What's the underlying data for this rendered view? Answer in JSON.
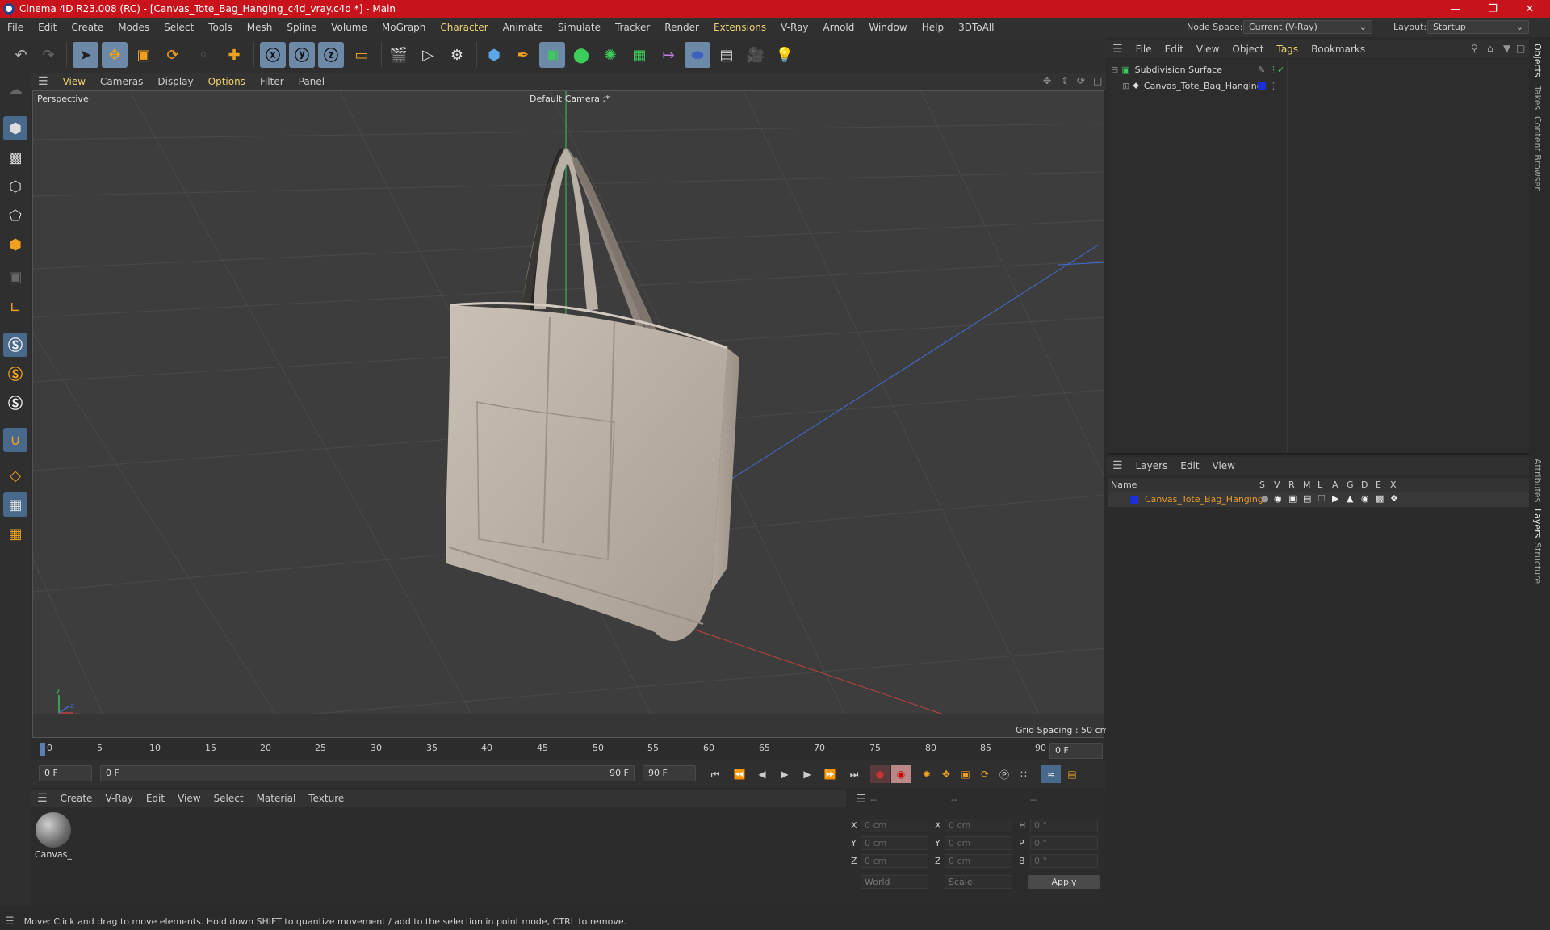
{
  "title": "Cinema 4D R23.008 (RC) - [Canvas_Tote_Bag_Hanging_c4d_vray.c4d *] - Main",
  "menu": [
    "File",
    "Edit",
    "Create",
    "Modes",
    "Select",
    "Tools",
    "Mesh",
    "Spline",
    "Volume",
    "MoGraph",
    "Character",
    "Animate",
    "Simulate",
    "Tracker",
    "Render",
    "Extensions",
    "V-Ray",
    "Arnold",
    "Window",
    "Help",
    "3DToAll"
  ],
  "node_space_label": "Node Space:",
  "node_space_value": "Current (V-Ray)",
  "layout_label": "Layout:",
  "layout_value": "Startup",
  "viewport": {
    "menu": [
      "View",
      "Cameras",
      "Display",
      "Options",
      "Filter",
      "Panel"
    ],
    "label": "Perspective",
    "camera": "Default Camera :*",
    "grid_spacing": "Grid Spacing : 50 cm"
  },
  "timeline": {
    "ticks": [
      "0",
      "5",
      "10",
      "15",
      "20",
      "25",
      "30",
      "35",
      "40",
      "45",
      "50",
      "55",
      "60",
      "65",
      "70",
      "75",
      "80",
      "85",
      "90"
    ],
    "current_frame_right": "0 F",
    "start": "0 F",
    "range_start": "0 F",
    "range_end": "90 F",
    "end": "90 F"
  },
  "materials": {
    "menu": [
      "Create",
      "V-Ray",
      "Edit",
      "View",
      "Select",
      "Material",
      "Texture"
    ],
    "items": [
      {
        "name": "Canvas_"
      }
    ]
  },
  "coords": {
    "headers": [
      "--",
      "--",
      "--"
    ],
    "rows": [
      {
        "a": "X",
        "av": "0 cm",
        "b": "X",
        "bv": "0 cm",
        "c": "H",
        "cv": "0 °"
      },
      {
        "a": "Y",
        "av": "0 cm",
        "b": "Y",
        "bv": "0 cm",
        "c": "P",
        "cv": "0 °"
      },
      {
        "a": "Z",
        "av": "0 cm",
        "b": "Z",
        "bv": "0 cm",
        "c": "B",
        "cv": "0 °"
      }
    ],
    "world": "World",
    "scale": "Scale",
    "apply": "Apply"
  },
  "objects": {
    "menu": [
      "File",
      "Edit",
      "View",
      "Object",
      "Tags",
      "Bookmarks"
    ],
    "items": [
      {
        "name": "Subdivision Surface"
      },
      {
        "name": "Canvas_Tote_Bag_Hanging"
      }
    ]
  },
  "layers": {
    "menu": [
      "Layers",
      "Edit",
      "View"
    ],
    "columns": [
      "Name",
      "S",
      "V",
      "R",
      "M",
      "L",
      "A",
      "G",
      "D",
      "E",
      "X"
    ],
    "items": [
      {
        "name": "Canvas_Tote_Bag_Hanging"
      }
    ]
  },
  "side_tabs": [
    "Objects",
    "Takes",
    "Content Browser",
    "Attributes",
    "Layers",
    "Structure"
  ],
  "status": "Move: Click and drag to move elements. Hold down SHIFT to quantize movement / add to the selection in point mode, CTRL to remove.",
  "colors": {
    "title_bar": "#c9131c",
    "highlight": "#f0d070",
    "layer_blue": "#1d2fd6",
    "layer_name": "#e89a2c"
  }
}
